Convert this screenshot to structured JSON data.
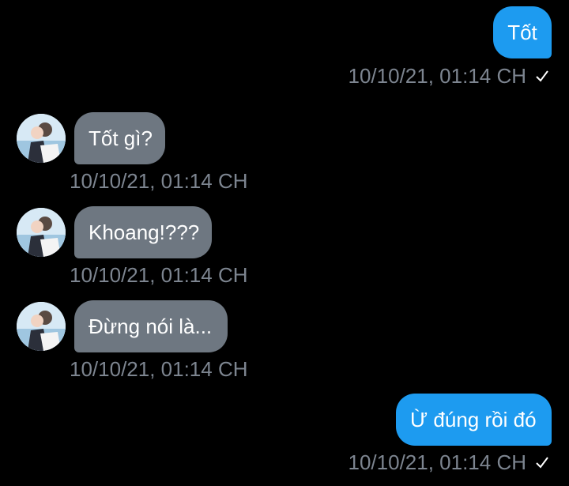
{
  "theme": {
    "background": "#000000",
    "sent_bubble_color": "#1d9bf0",
    "received_bubble_color": "#6e7781",
    "timestamp_color": "#7d8590"
  },
  "messages": [
    {
      "direction": "sent",
      "text": "Tốt",
      "timestamp": "10/10/21, 01:14 CH",
      "status_icon": "checkmark-icon"
    },
    {
      "direction": "received",
      "text": "Tốt gì?",
      "timestamp": "10/10/21, 01:14 CH",
      "avatar": "contact-avatar"
    },
    {
      "direction": "received",
      "text": "Khoang!???",
      "timestamp": "10/10/21, 01:14 CH",
      "avatar": "contact-avatar"
    },
    {
      "direction": "received",
      "text": "Đừng nói là...",
      "timestamp": "10/10/21, 01:14 CH",
      "avatar": "contact-avatar"
    },
    {
      "direction": "sent",
      "text": "Ừ đúng rồi đó",
      "timestamp": "10/10/21, 01:14 CH",
      "status_icon": "checkmark-icon"
    }
  ]
}
